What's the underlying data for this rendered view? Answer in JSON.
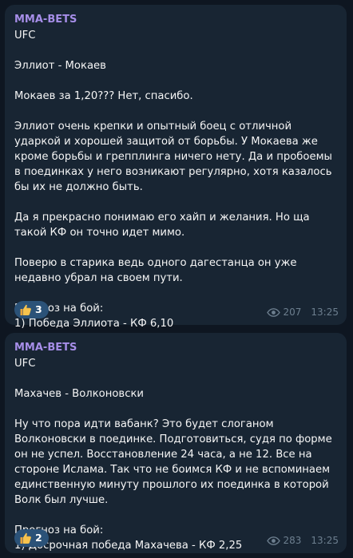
{
  "colors": {
    "background": "#0e1621",
    "bubble": "#182533",
    "sender": "#a68ee8",
    "meta": "#6d7f8f",
    "reaction_bg": "#2b5278"
  },
  "messages": [
    {
      "sender": "MMA-BETS",
      "text": "UFC\n\nЭллиот - Мокаев\n\nМокаев за 1,20??? Нет, спасибо.\n\nЭллиот очень крепки и опытный боец с отличной ударкой и хорошей защитой от борьбы. У Мокаева же кроме борьбы и грепплинга ничего нету. Да и пробоемы в поединках у него возникают регулярно, хотя казалось бы их не должно быть.\n\nДа я прекрасно понимаю его хайп и желания. Но ща такой КФ он точно идет мимо.\n\nПоверю в старика ведь одного дагестанца он уже недавно убрал на своем пути.\n\nПрогноз на бой:\n1) Победа Эллиота - КФ 6,10",
      "reaction": {
        "emoji": "thumbs-up-icon",
        "count": "3"
      },
      "views": "207",
      "time": "13:25"
    },
    {
      "sender": "MMA-BETS",
      "text": "UFC\n\nМахачев - Волконовски\n\nНу что пора идти вабанк? Это будет слоганом Волконовски в поединке. Подготовиться, судя по форме он не успел. Восстановление 24 часа, а не 12. Все на стороне Ислама. Так что не боимся КФ и не вспоминаем единственную минуту прошлого их поединка в которой Волк был лучше.\n\nПрогноз на бой:\n1) Досрочная победа Махачева - КФ 2,25",
      "reaction": {
        "emoji": "thumbs-up-icon",
        "count": "2"
      },
      "views": "283",
      "time": "13:25"
    }
  ]
}
